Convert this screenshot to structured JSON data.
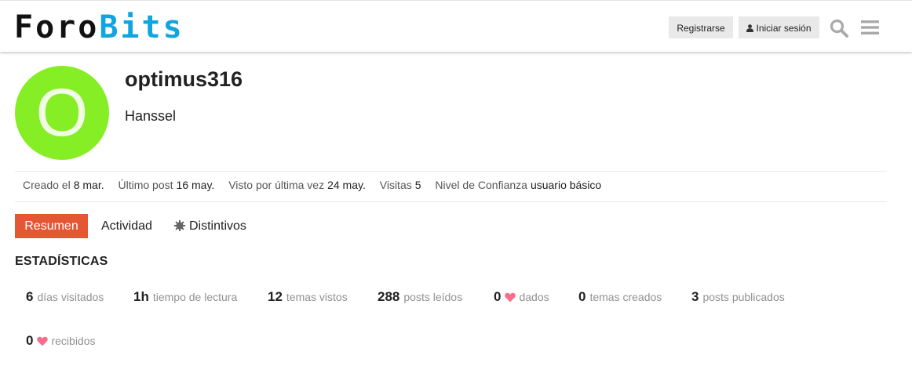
{
  "header": {
    "logo_part1": "Foro",
    "logo_part2": "Bits",
    "register_label": "Registrarse",
    "login_label": "Iniciar sesión",
    "icons": [
      "user-icon",
      "search-icon",
      "hamburger-menu-icon"
    ]
  },
  "colors": {
    "accent": "#e45735",
    "avatar_bg": "#86ee24",
    "logo_blue": "#0fa5e0",
    "heart": "#fa6c8d"
  },
  "profile": {
    "avatar_letter": "O",
    "username": "optimus316",
    "name": "Hanssel",
    "meta": [
      {
        "label": "Creado el",
        "value": "8 mar."
      },
      {
        "label": "Último post",
        "value": "16 may."
      },
      {
        "label": "Visto por última vez",
        "value": "24 may."
      },
      {
        "label": "Visitas",
        "value": "5"
      },
      {
        "label": "Nivel de Confianza",
        "value": "usuario básico"
      }
    ]
  },
  "tabs": [
    {
      "label": "Resumen",
      "active": true
    },
    {
      "label": "Actividad"
    },
    {
      "label": "Distintivos",
      "icon": "gear-icon"
    }
  ],
  "stats": {
    "title": "ESTADÍSTICAS",
    "items": [
      {
        "value": "6",
        "label": "días visitados"
      },
      {
        "value": "1h",
        "label": "tiempo de lectura"
      },
      {
        "value": "12",
        "label": "temas vistos"
      },
      {
        "value": "288",
        "label": "posts leídos"
      },
      {
        "value": "0",
        "label": "dados",
        "icon": "heart-icon"
      },
      {
        "value": "0",
        "label": "temas creados"
      },
      {
        "value": "3",
        "label": "posts publicados"
      },
      {
        "value": "0",
        "label": "recibidos",
        "icon": "heart-icon"
      }
    ]
  }
}
